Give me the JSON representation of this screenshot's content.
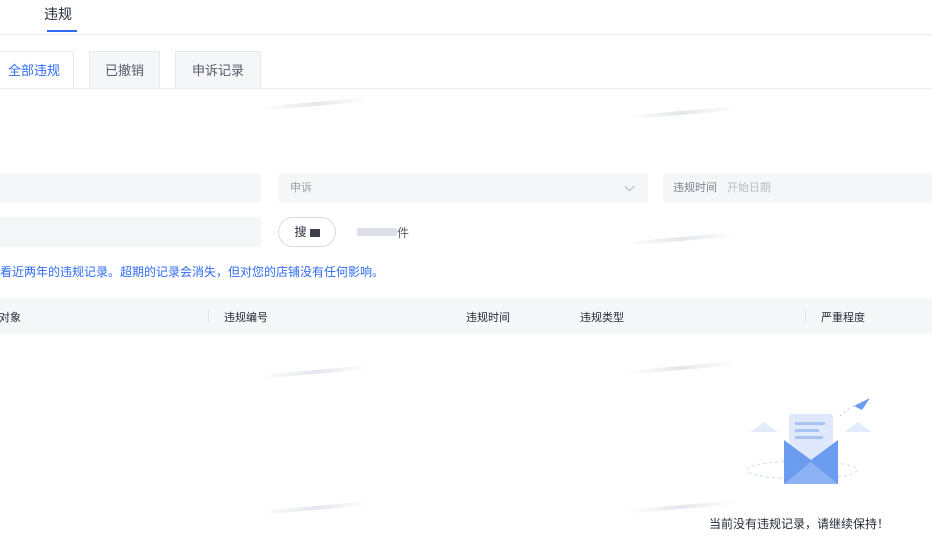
{
  "nav": {
    "active_tab": "违规"
  },
  "tabs": [
    {
      "label": "全部违规",
      "active": true
    },
    {
      "label": "已撤销",
      "active": false
    },
    {
      "label": "申诉记录",
      "active": false
    }
  ],
  "filters": {
    "appeal_select": {
      "value": "申诉"
    },
    "violation_time": {
      "label": "违规时间",
      "placeholder": "开始日期"
    }
  },
  "actions": {
    "search_label": "搜",
    "filter_label": "件"
  },
  "notice": "查看近两年的违规记录。超期的记录会消失，但对您的店铺没有任何影响。",
  "table": {
    "columns": [
      "规对象",
      "违规编号",
      "违规时间",
      "违规类型",
      "严重程度"
    ]
  },
  "empty_state": {
    "text": "当前没有违规记录，请继续保持！"
  },
  "colors": {
    "accent": "#2f6bf1",
    "header_bg": "#f6f7f9",
    "field_bg": "#f5f6f8"
  }
}
